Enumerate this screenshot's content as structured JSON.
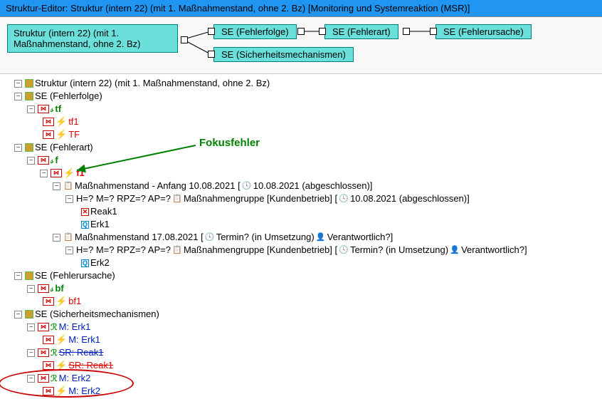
{
  "title": "Struktur-Editor: Struktur (intern 22) (mit 1. Maßnahmenstand, ohne 2. Bz) [Monitoring und Systemreaktion (MSR)]",
  "diagram": {
    "root": "Struktur (intern 22) (mit 1. Maßnahmenstand, ohne 2. Bz)",
    "b1": "SE (Fehlerfolge)",
    "b2": "SE (Fehlerart)",
    "b3": "SE (Fehlerursache)",
    "b4": "SE (Sicherheitsmechanismen)"
  },
  "annotation": {
    "label": "Fokusfehler"
  },
  "tree": {
    "n0": "Struktur (intern 22) (mit 1. Maßnahmenstand, ohne 2. Bz)",
    "n1": "SE (Fehlerfolge)",
    "n1a": "tf",
    "n1b": "tf1",
    "n1c": "TF",
    "n2": "SE (Fehlerart)",
    "n2a": "f",
    "n2b": "f1",
    "n2c": "Maßnahmenstand - Anfang 10.08.2021 [",
    "n2c2": " 10.08.2021 (abgeschlossen)]",
    "n2d": "H=? M=? RPZ=? AP=? ",
    "n2d2": "Maßnahmengruppe [Kundenbetrieb] [",
    "n2d3": " 10.08.2021 (abgeschlossen)]",
    "n2e": "Reak1",
    "n2f": "Erk1",
    "n2g": "Maßnahmenstand 17.08.2021 [",
    "n2g2": " Termin? (in Umsetzung) ",
    "n2g3": " Verantwortlich?]",
    "n2h": "H=? M=? RPZ=? AP=? ",
    "n2h2": "Maßnahmengruppe [Kundenbetrieb] [",
    "n2h3": " Termin? (in Umsetzung) ",
    "n2h4": " Verantwortlich?]",
    "n2i": "Erk2",
    "n3": "SE (Fehlerursache)",
    "n3a": "bf",
    "n3b": "bf1",
    "n4": "SE (Sicherheitsmechanismen)",
    "n4a": "M: Erk1",
    "n4b": "M: Erk1",
    "n4c": "SR: Reak1",
    "n4d": "SR: Reak1",
    "n4e": "M: Erk2",
    "n4f": "M: Erk2"
  }
}
